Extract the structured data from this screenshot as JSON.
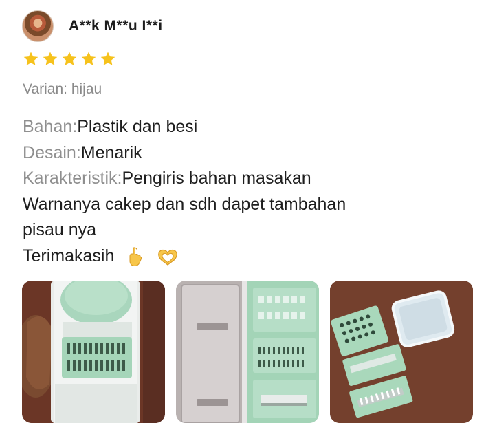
{
  "reviewer": {
    "name": "A**k M**u I**i"
  },
  "rating": {
    "value": 5,
    "max": 5,
    "color": "#f6c21c"
  },
  "variant": {
    "text": "Varian: hijau"
  },
  "attributes": [
    {
      "label": "Bahan:",
      "value": "Plastik dan besi"
    },
    {
      "label": "Desain:",
      "value": "Menarik"
    },
    {
      "label": "Karakteristik:",
      "value": "Pengiris bahan masakan"
    }
  ],
  "comment": {
    "lines": [
      "Warnanya cakep dan sdh dapet tambahan",
      "pisau nya",
      "Terimakasih"
    ]
  },
  "emojis": [
    "hand-with-index-finger-and-thumb-crossed-icon",
    "heart-hands-icon"
  ],
  "photos": [
    {
      "name": "slicer-in-hand-photo"
    },
    {
      "name": "slicer-container-open-photo"
    },
    {
      "name": "slicer-blades-set-photo"
    }
  ]
}
